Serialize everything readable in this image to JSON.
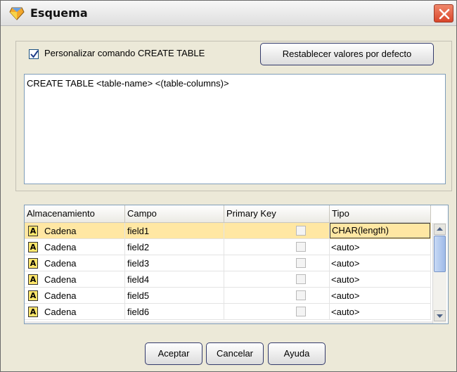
{
  "window": {
    "title": "Esquema"
  },
  "options": {
    "customize_label": "Personalizar comando CREATE TABLE",
    "customize_checked": true,
    "reset_button": "Restablecer valores por defecto"
  },
  "sql": {
    "text": "CREATE TABLE <table-name> <(table-columns)>"
  },
  "table": {
    "headers": [
      "Almacenamiento",
      "Campo",
      "Primary Key",
      "Tipo"
    ],
    "rows": [
      {
        "icon": "A",
        "storage": "Cadena",
        "field": "field1",
        "primary_key": false,
        "type": "CHAR(length)"
      },
      {
        "icon": "A",
        "storage": "Cadena",
        "field": "field2",
        "primary_key": false,
        "type": "<auto>"
      },
      {
        "icon": "A",
        "storage": "Cadena",
        "field": "field3",
        "primary_key": false,
        "type": "<auto>"
      },
      {
        "icon": "A",
        "storage": "Cadena",
        "field": "field4",
        "primary_key": false,
        "type": "<auto>"
      },
      {
        "icon": "A",
        "storage": "Cadena",
        "field": "field5",
        "primary_key": false,
        "type": "<auto>"
      },
      {
        "icon": "A",
        "storage": "Cadena",
        "field": "field6",
        "primary_key": false,
        "type": "<auto>"
      }
    ]
  },
  "buttons": {
    "ok": "Aceptar",
    "cancel": "Cancelar",
    "help": "Ayuda"
  },
  "colors": {
    "selected_row": "#ffe7a3",
    "close_button": "#d9452a",
    "button_border": "#333a6b"
  }
}
